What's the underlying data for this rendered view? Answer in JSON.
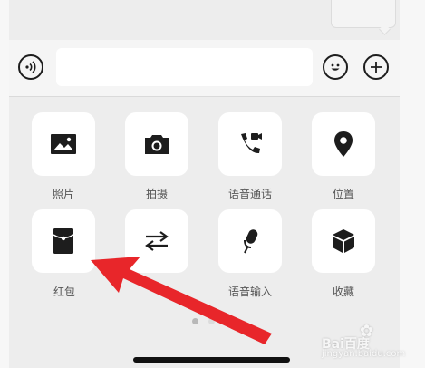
{
  "input_bar": {
    "message_value": "",
    "voice_icon": "voice-mode-icon",
    "emoji_icon": "emoji-icon",
    "plus_icon": "plus-icon"
  },
  "panel": {
    "items": [
      {
        "label": "照片",
        "icon": "photo-icon"
      },
      {
        "label": "拍摄",
        "icon": "camera-icon"
      },
      {
        "label": "语音通话",
        "icon": "voice-video-call-icon"
      },
      {
        "label": "位置",
        "icon": "location-icon"
      },
      {
        "label": "红包",
        "icon": "red-packet-icon"
      },
      {
        "label": "",
        "icon": "transfer-icon"
      },
      {
        "label": "语音输入",
        "icon": "microphone-icon"
      },
      {
        "label": "收藏",
        "icon": "favorites-icon"
      }
    ],
    "pages": 2,
    "current_page": 1
  },
  "annotation": {
    "arrow_color": "#e8262a",
    "target": "红包"
  },
  "watermark": {
    "main": "Bai百度",
    "sub": "jingyan.baidu.com"
  },
  "colors": {
    "icon": "#1d1d1d",
    "tile_bg": "#ffffff",
    "panel_bg": "#ededed"
  }
}
